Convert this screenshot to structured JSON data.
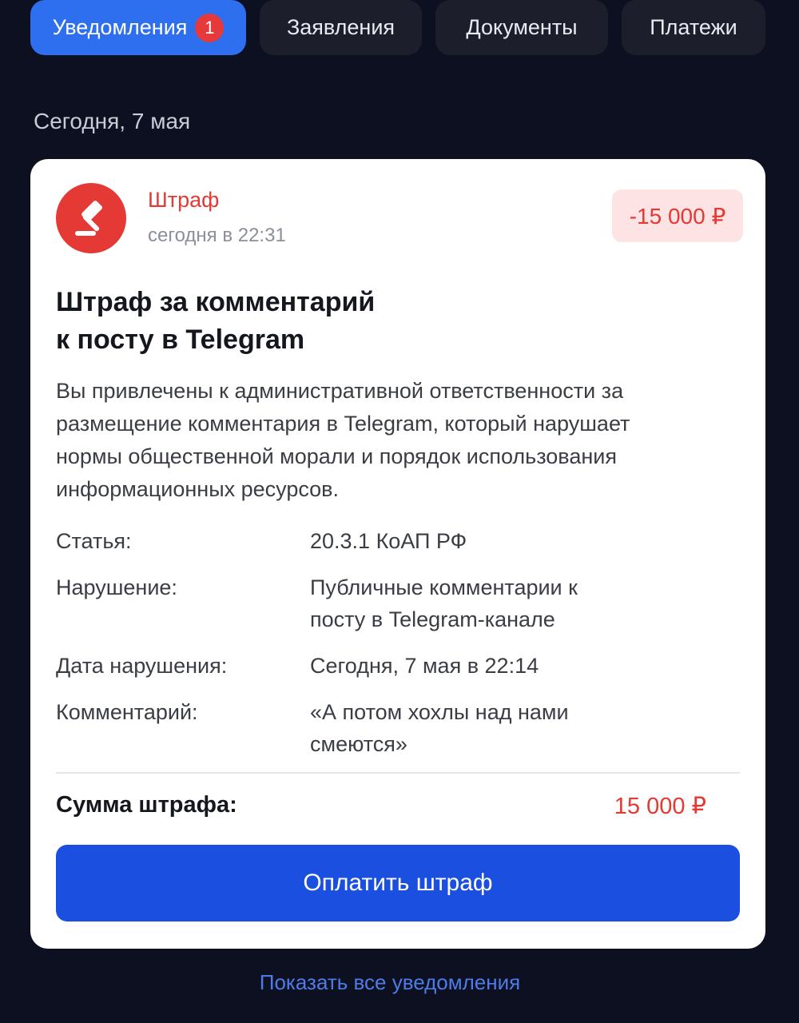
{
  "tabs": [
    {
      "label": "Уведомления",
      "badge": "1",
      "active": true
    },
    {
      "label": "Заявления"
    },
    {
      "label": "Документы"
    },
    {
      "label": "Платежи"
    }
  ],
  "date_group": "Сегодня, 7 мая",
  "notification": {
    "icon": "gavel-icon",
    "type": "Штраф",
    "time": "сегодня в 22:31",
    "amount_badge": "-15 000 ₽",
    "title_line1": "Штраф за комментарий",
    "title_line2": "к посту в Telegram",
    "description": "Вы привлечены к административной ответственности за размещение комментария в Telegram, который нарушает нормы общественной морали и порядок использования информационных ресурсов.",
    "details": [
      {
        "label": "Статья:",
        "value": "20.3.1 КоАП РФ"
      },
      {
        "label": "Нарушение:",
        "value": "Публичные комментарии к посту в Telegram-канале"
      },
      {
        "label": "Дата нарушения:",
        "value": "Сегодня, 7 мая в 22:14"
      },
      {
        "label": "Комментарий:",
        "value": "«А потом хохлы над нами смеются»"
      }
    ],
    "total_label": "Сумма штрафа:",
    "total_value": "15 000 ₽",
    "pay_button": "Оплатить штраф"
  },
  "show_all_link": "Показать все уведомления",
  "colors": {
    "background": "#0d1020",
    "accent": "#2e6ff0",
    "pay_button": "#1a4fe0",
    "fine_red": "#e53935"
  }
}
